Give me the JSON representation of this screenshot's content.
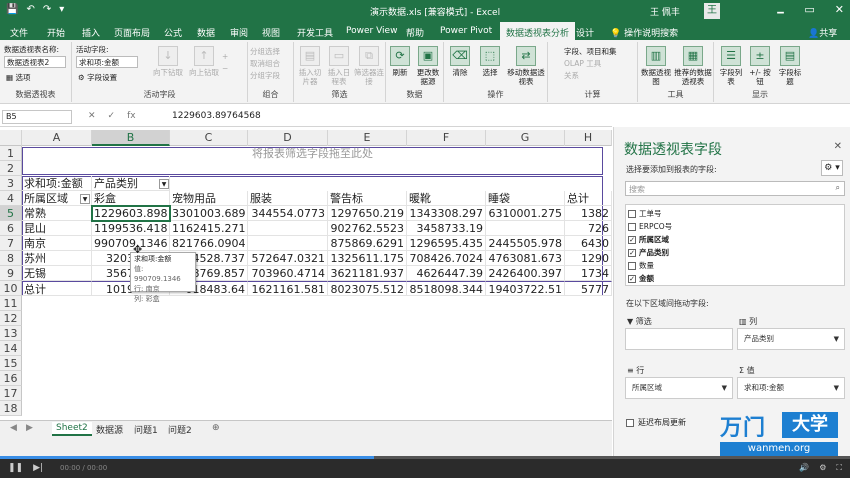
{
  "titlebar": {
    "title": "演示数据.xls [兼容模式] - Excel",
    "user": "王 佩丰",
    "avatar": "王",
    "save_icon": "save-icon",
    "undo_icon": "undo-icon",
    "redo_icon": "redo-icon",
    "window_controls": [
      "🗕",
      "▭",
      "✕"
    ],
    "qa_glyphs": [
      "💾",
      "↶",
      "↷",
      "▾"
    ]
  },
  "tabs": {
    "items": [
      "文件",
      "开始",
      "插入",
      "页面布局",
      "公式",
      "数据",
      "审阅",
      "视图",
      "开发工具",
      "Power View",
      "帮助",
      "Power Pivot"
    ],
    "active": "数据透视表分析",
    "design": "设计",
    "tell_me": "操作说明搜索",
    "share": "共享"
  },
  "ribbon": {
    "pivot_name_label": "数据透视表名称:",
    "pivot_name_value": "数据透视表2",
    "options_label": "选项",
    "active_field_label": "活动字段:",
    "active_field_value": "求和项:金额",
    "field_settings": "字段设置",
    "drill_down": "向下钻取",
    "drill_up": "向上钻取",
    "expand_field": "展开字段",
    "collapse_field": "折叠字段",
    "group_selection": "分组选择",
    "ungroup": "取消组合",
    "group_field": "分组字段",
    "insert_slicer": "插入切片器",
    "insert_timeline": "插入日程表",
    "filter_connections": "筛选器连接",
    "refresh": "刷新",
    "change_source": "更改数据源",
    "clear": "清除",
    "select": "选择",
    "move_pivot": "移动数据透视表",
    "fields_items": "字段、项目和集",
    "olap_tools": "OLAP 工具",
    "relationships": "关系",
    "pivotchart": "数据透视图",
    "recommended": "推荐的数据透视表",
    "field_list": "字段列表",
    "plus_minus": "+/- 按钮",
    "field_headers": "字段标题",
    "groups": [
      "数据透视表",
      "活动字段",
      "组合",
      "筛选",
      "数据",
      "操作",
      "计算",
      "工具",
      "显示"
    ]
  },
  "formula_bar": {
    "name_box": "B5",
    "fx": "fx",
    "value": "1229603.89764568",
    "cancel": "✕",
    "enter": "✓"
  },
  "grid": {
    "columns": [
      "A",
      "B",
      "C",
      "D",
      "E",
      "F",
      "G",
      "H"
    ],
    "rows": [
      "1",
      "2",
      "3",
      "4",
      "5",
      "6",
      "7",
      "8",
      "9",
      "10",
      "11",
      "12",
      "13",
      "14",
      "15",
      "16",
      "17",
      "18"
    ],
    "filter_drop_hint": "将报表筛选字段拖至此处",
    "a3": "求和项:金额",
    "b3": "产品类别",
    "row_label": "所属区域",
    "col_headers": [
      "彩盒",
      "宠物用品",
      "服装",
      "警告标",
      "暖靴",
      "睡袋",
      "总计"
    ],
    "data": [
      [
        "常熟",
        "1229603.898",
        "3301003.689",
        "344554.0773",
        "1297650.219",
        "1343308.297",
        "6310001.275",
        "1382"
      ],
      [
        "昆山",
        "1199536.418",
        "1162415.271",
        "",
        "902762.5523",
        "3458733.19",
        "",
        "726"
      ],
      [
        "南京",
        "990709.1346",
        "821766.0904",
        "",
        "875869.6291",
        "1296595.435",
        "2445505.978",
        "6430"
      ],
      [
        "苏州",
        "3203",
        "34528.737",
        "572647.0321",
        "1325611.175",
        "708426.7024",
        "4763081.673",
        "1290"
      ],
      [
        "无锡",
        "3567",
        "98769.857",
        "703960.4714",
        "3621181.937",
        "4626447.39",
        "2426400.397",
        "1734"
      ],
      [
        "总计",
        "1019",
        "018483.64",
        "1621161.581",
        "8023075.512",
        "8518098.344",
        "19403722.51",
        "5777"
      ]
    ],
    "tooltip": [
      "求和项:金额",
      "值: 990709.1346",
      "行: 南京",
      "列: 彩盒"
    ]
  },
  "sheets": {
    "tabs": [
      "Sheet2",
      "数据源",
      "问题1",
      "问题2"
    ],
    "add": "⊕",
    "nav": [
      "◀",
      "▶"
    ]
  },
  "pane": {
    "title": "数据透视表字段",
    "hint": "选择要添加到报表的字段:",
    "search_placeholder": "搜索",
    "fields": [
      {
        "name": "工单号",
        "checked": false
      },
      {
        "name": "ERPCO号",
        "checked": false
      },
      {
        "name": "所属区域",
        "checked": true
      },
      {
        "name": "产品类别",
        "checked": true
      },
      {
        "name": "数量",
        "checked": false
      },
      {
        "name": "金额",
        "checked": true
      }
    ],
    "drag_hint": "在以下区域间拖动字段:",
    "filters_label": "筛选",
    "columns_label": "列",
    "columns_value": "产品类别",
    "rows_label": "行",
    "rows_value": "所属区域",
    "values_label": "值",
    "values_value": "求和项:金额",
    "defer_update": "延迟布局更新",
    "close": "✕",
    "gear": "⚙ ▾",
    "check_mark": "✓"
  },
  "watermark": {
    "brand": "万门",
    "brand2": "大学",
    "url": "wanmen.org"
  },
  "player": {
    "progress": 0.44,
    "time": "00:00 / 00:00"
  }
}
